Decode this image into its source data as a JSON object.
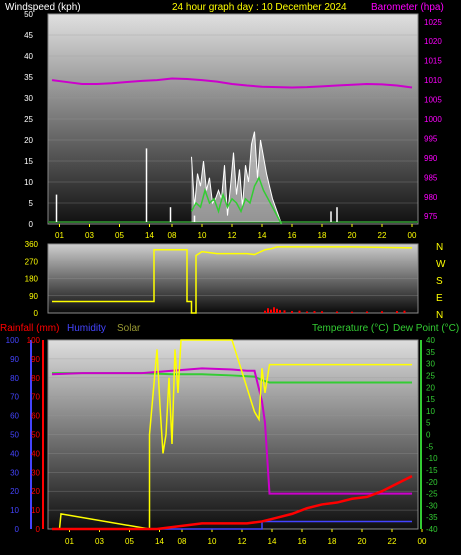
{
  "header": {
    "windspeed_title": "Windspeed (kph)",
    "date_title": "24 hour graph day : 10 December 2024",
    "barometer_title": "Barometer (hpa)"
  },
  "compass_letters": [
    "N",
    "W",
    "S",
    "E",
    "N"
  ],
  "lower_header": {
    "rainfall": "Rainfall (mm)",
    "humidity": "Humidity",
    "solar": "Solar",
    "temperature": "Temperature (°C)",
    "dewpoint": "Dew Point (°C)"
  },
  "colors": {
    "wind": "#ffffff",
    "gust": "#ffffff",
    "wind_avg": "#33cc33",
    "barometer": "#cc00cc",
    "direction": "#ffff00",
    "rain": "#ff0000",
    "humidity": "#4444ff",
    "solar": "#ffff00",
    "temperature": "#cc00cc",
    "dewpoint": "#33cc33",
    "xaxis": "#ffff00",
    "left_axis": "#ffffff",
    "right_axis": "#ff00ff",
    "dir_axis": "#ffff00",
    "rain_axis": "#ff0000",
    "temp_axis": "#33cc33"
  },
  "x_ticks": [
    "01",
    "03",
    "05",
    "14",
    "08",
    "10",
    "12",
    "14",
    "16",
    "18",
    "20",
    "22",
    "00"
  ],
  "x_ticks_lower": [
    "01",
    "03",
    "05",
    "14",
    "08",
    "10",
    "12",
    "14",
    "16",
    "18",
    "20",
    "22",
    "00"
  ],
  "chart_data": [
    {
      "type": "line",
      "name": "wind",
      "left_axis_ticks": [
        "0",
        "5",
        "10",
        "15",
        "20",
        "25",
        "30",
        "35",
        "40",
        "45",
        "50"
      ],
      "right_axis_ticks": [
        "975",
        "980",
        "985",
        "990",
        "995",
        "1000",
        "1005",
        "1010",
        "1015",
        "1020",
        "1025"
      ],
      "ylim_wind": [
        0,
        50
      ],
      "ylim_baro": [
        973,
        1027
      ],
      "x_hours": [
        0,
        24
      ],
      "barometer": {
        "x": [
          0,
          1,
          2,
          3,
          4,
          5,
          6,
          7,
          8,
          9,
          10,
          11,
          12,
          13,
          14,
          15,
          16,
          17,
          18,
          19,
          20,
          21,
          22,
          23,
          24
        ],
        "y": [
          1010,
          1009.5,
          1009,
          1009,
          1009.2,
          1009.5,
          1009.8,
          1010,
          1010.4,
          1010.3,
          1010,
          1009.6,
          1009,
          1008.6,
          1008.3,
          1008.2,
          1008.1,
          1008.2,
          1008.4,
          1008.6,
          1008.8,
          1009,
          1008.9,
          1008.6,
          1008.1
        ]
      },
      "wind_spikes": [
        {
          "x": 0.3,
          "y": 7
        },
        {
          "x": 6.3,
          "y": 18
        },
        {
          "x": 7.9,
          "y": 4
        },
        {
          "x": 9.5,
          "y": 2
        },
        {
          "x": 18.6,
          "y": 3
        },
        {
          "x": 19.0,
          "y": 4
        }
      ],
      "gust": {
        "x": [
          9.3,
          9.5,
          9.7,
          9.9,
          10.1,
          10.3,
          10.5,
          10.7,
          10.9,
          11.1,
          11.3,
          11.5,
          11.7,
          11.9,
          12.1,
          12.3,
          12.5,
          12.7,
          12.9,
          13.1,
          13.3,
          13.5,
          13.7,
          13.9,
          14.1,
          14.3,
          14.5,
          14.7,
          14.9,
          15.1,
          15.3
        ],
        "y": [
          16,
          4,
          12,
          9,
          15,
          8,
          11,
          5,
          6,
          8,
          6,
          14,
          2,
          9,
          17,
          7,
          13,
          4,
          14,
          10,
          19,
          22,
          11,
          20,
          16,
          12,
          9,
          6,
          4,
          2,
          0
        ]
      },
      "wind_avg": {
        "x": [
          9.3,
          9.6,
          9.9,
          10.2,
          10.5,
          10.8,
          11.1,
          11.4,
          11.7,
          12.0,
          12.3,
          12.6,
          12.9,
          13.2,
          13.5,
          13.8,
          14.1,
          14.4,
          14.7,
          15.0,
          15.3
        ],
        "y": [
          3,
          5,
          4,
          8,
          5,
          6,
          3,
          7,
          4,
          6,
          5,
          3,
          6,
          5,
          9,
          11,
          8,
          6,
          4,
          2,
          0
        ]
      }
    },
    {
      "type": "line",
      "name": "wind-direction",
      "left_axis_ticks": [
        "0",
        "90",
        "180",
        "270",
        "360"
      ],
      "ylim": [
        0,
        360
      ],
      "direction": {
        "x": [
          0,
          6.8,
          6.8,
          9.0,
          9.0,
          9.3,
          9.3,
          9.6,
          9.6,
          10.0,
          11.0,
          13.0,
          13.5,
          14.2,
          14.6,
          15.0,
          20.0,
          24
        ],
        "y": [
          60,
          60,
          330,
          330,
          60,
          60,
          0,
          0,
          300,
          320,
          310,
          310,
          305,
          330,
          335,
          345,
          345,
          340
        ]
      },
      "rain_rate_bars": {
        "x": [
          14.2,
          14.4,
          14.6,
          14.8,
          15.0,
          15.2,
          15.5,
          16.0,
          16.5,
          17.0,
          17.5,
          18.0,
          19.0,
          20.0,
          21.0,
          22.0,
          23.0,
          23.5
        ],
        "y": [
          12,
          25,
          18,
          30,
          22,
          15,
          14,
          10,
          12,
          8,
          10,
          9,
          8,
          7,
          8,
          9,
          10,
          12
        ]
      }
    },
    {
      "type": "line",
      "name": "temperature-humidity-rain",
      "left_axis_ticks": [
        "0",
        "10",
        "20",
        "30",
        "40",
        "50",
        "60",
        "70",
        "80",
        "90",
        "100"
      ],
      "right_axis_ticks": [
        "-40",
        "-35",
        "-30",
        "-25",
        "-20",
        "-15",
        "-10",
        "-5",
        "0",
        "5",
        "10",
        "15",
        "20",
        "25",
        "30",
        "35",
        "40"
      ],
      "ylim_left": [
        0,
        100
      ],
      "ylim_right": [
        -40,
        40
      ],
      "humidity": {
        "x": [
          0,
          14.0,
          14.0,
          24
        ],
        "y": [
          0,
          0,
          4,
          4
        ]
      },
      "solar": {
        "x": [
          0,
          0.5,
          0.6,
          6.5,
          6.5,
          7.0,
          7.2,
          7.4,
          7.6,
          7.8,
          8.0,
          8.2,
          8.4,
          8.6,
          8.8,
          9.0,
          9.2,
          9.5,
          9.8,
          10.0,
          10.2,
          10.5,
          11.0,
          12.0,
          13.5,
          13.8,
          14.0,
          14.2,
          14.5,
          24
        ],
        "y": [
          0,
          0,
          8,
          0,
          50,
          95,
          65,
          40,
          50,
          80,
          45,
          95,
          72,
          100,
          100,
          100,
          100,
          100,
          100,
          100,
          100,
          100,
          100,
          100,
          62,
          58,
          85,
          72,
          87,
          87
        ]
      },
      "temperature": {
        "x": [
          0,
          2,
          4,
          6,
          8,
          10,
          12,
          13,
          13.5,
          14.0,
          14.2,
          14.5,
          15,
          16,
          18,
          20,
          22,
          24
        ],
        "y": [
          25.5,
          26,
          26,
          26,
          27,
          28,
          27.5,
          27,
          27,
          14,
          5,
          -25,
          -25,
          -25,
          -25,
          -25,
          -25,
          -25
        ]
      },
      "dewpoint": {
        "x": [
          0,
          2,
          4,
          6,
          8,
          10,
          12,
          13.5,
          14.0,
          14.5,
          15,
          18,
          20,
          22,
          24
        ],
        "y": [
          26,
          26,
          26,
          26,
          25.5,
          25.5,
          25,
          24.5,
          23,
          22,
          22,
          22,
          22,
          22,
          22
        ]
      },
      "rainfall": {
        "x": [
          0,
          4,
          6,
          7,
          8,
          9,
          10,
          11,
          12,
          13,
          14,
          15,
          16,
          17,
          18,
          19,
          20,
          21,
          22,
          23,
          24
        ],
        "y": [
          0,
          0,
          0,
          0,
          1,
          2,
          3,
          3,
          3,
          3,
          4,
          6,
          8,
          11,
          13,
          14,
          16,
          17,
          20,
          24,
          28
        ]
      }
    }
  ]
}
